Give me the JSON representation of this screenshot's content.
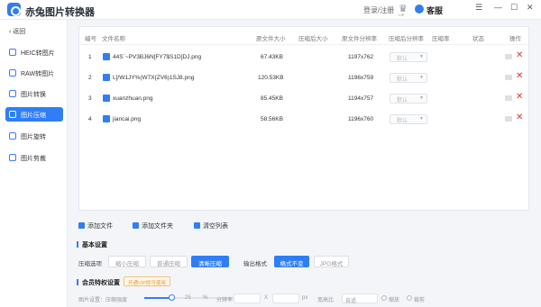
{
  "app": {
    "title": "赤兔图片转换器"
  },
  "header": {
    "login": "登录/注册",
    "crown_sub": "VIP",
    "service": "客服",
    "win_menu": "☰",
    "win_min": "—",
    "win_max": "☐",
    "win_close": "✕"
  },
  "sidebar": {
    "back": "返回",
    "items": [
      {
        "label": "HEIC转图片"
      },
      {
        "label": "RAW转图片"
      },
      {
        "label": "图片转换"
      },
      {
        "label": "图片压缩"
      },
      {
        "label": "图片旋转"
      },
      {
        "label": "图片剪裁"
      }
    ]
  },
  "table": {
    "headers": [
      "编号",
      "文件名称",
      "原文件大小",
      "压缩后大小",
      "原文件分辨率",
      "压缩后分辨率",
      "压缩率",
      "状态",
      "操作"
    ],
    "rows": [
      {
        "no": "1",
        "name": "44S`~PV3BJ6N[FY7$S1D]DJ.png",
        "size": "67.43KB",
        "res": "1197x762",
        "select": "默认"
      },
      {
        "no": "2",
        "name": "L]/W1JY%(W7X{ZV6)1SJ8.png",
        "size": "120.53KB",
        "res": "1196x759",
        "select": "默认"
      },
      {
        "no": "3",
        "name": "xuanzhuan.png",
        "size": "85.45KB",
        "res": "1194x757",
        "select": "默认"
      },
      {
        "no": "4",
        "name": "jiancai.png",
        "size": "58.56KB",
        "res": "1196x760",
        "select": "默认"
      }
    ]
  },
  "toolbar": {
    "add_file": "添加文件",
    "add_folder": "添加文件夹",
    "clear": "清空列表"
  },
  "basic": {
    "title": "基本设置",
    "compress_label": "压缩选项",
    "compress_opts": [
      "缩小压缩",
      "普通压缩",
      "清晰压缩"
    ],
    "output_label": "输出格式",
    "output_opts": [
      "格式不变",
      "JPG格式"
    ]
  },
  "vip": {
    "title": "会员特权设置",
    "badge": "开通VIP即可使用"
  },
  "bottom": {
    "label": "图片设置：压缩强度",
    "percent": "25",
    "percent_unit": "%",
    "res_label": "分辨率",
    "x": "X",
    "px": "px",
    "ratio_label": "宽高比",
    "ratio_value": "自适",
    "radio1": "缩放",
    "radio2": "裁剪"
  },
  "slider": {
    "value": 0.25
  }
}
